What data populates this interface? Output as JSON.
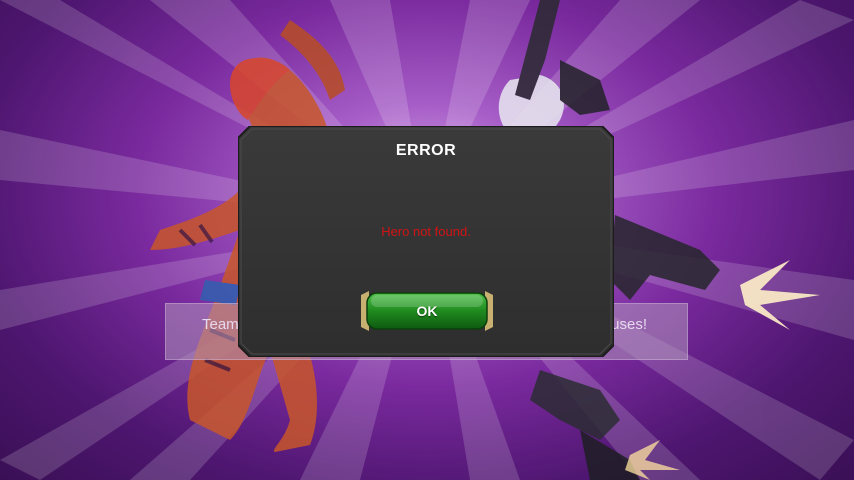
{
  "background": {
    "hint_text_left": "Team",
    "hint_text_right": "uses!"
  },
  "dialog": {
    "title": "ERROR",
    "message": "Hero not found.",
    "ok_label": "OK"
  },
  "colors": {
    "dialog_bg": "#353535",
    "message": "#d11414",
    "button_green": "#1f8a1f",
    "button_gold": "#c8b070"
  }
}
